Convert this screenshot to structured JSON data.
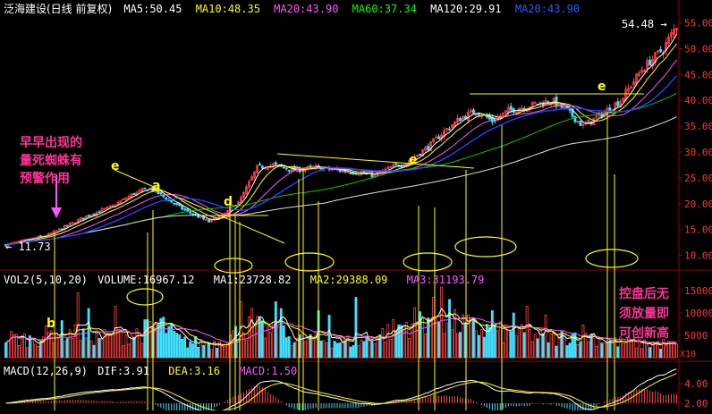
{
  "header": {
    "title": "泛海建设(日线 前复权)",
    "ma_items": [
      {
        "label": "MA5:50.45",
        "color": "#ffffff"
      },
      {
        "label": "MA10:48.35",
        "color": "#ffff00"
      },
      {
        "label": "MA20:43.90",
        "color": "#ff55ff"
      },
      {
        "label": "MA60:37.34",
        "color": "#00ff00"
      },
      {
        "label": "MA120:29.91",
        "color": "#ffffff"
      },
      {
        "label": "MA20:43.90",
        "color": "#3355ff"
      }
    ]
  },
  "volume_header": {
    "items": [
      {
        "label": "VOL2(5,10,20)",
        "color": "#ffffff"
      },
      {
        "label": "VOLUME:16967.12",
        "color": "#ffffff"
      },
      {
        "label": "MA1:23728.82",
        "color": "#ffffff"
      },
      {
        "label": "MA2:29388.09",
        "color": "#ffff00"
      },
      {
        "label": "MA3:31193.79",
        "color": "#ff55ff"
      }
    ]
  },
  "macd_header": {
    "items": [
      {
        "label": "MACD(12,26,9)",
        "color": "#ffffff"
      },
      {
        "label": "DIF:3.91",
        "color": "#ffffff"
      },
      {
        "label": "DEA:3.16",
        "color": "#ffff00"
      },
      {
        "label": "MACD:1.50",
        "color": "#ff55ff"
      }
    ]
  },
  "annotations": {
    "note_left": [
      "早早出现的",
      "量死蜘蛛有",
      "预警作用"
    ],
    "note_right": [
      "控盘后无",
      "须放量即",
      "可创新高"
    ],
    "low_label": "11.73",
    "high_label": "54.48",
    "letters": [
      "e",
      "a",
      "d",
      "e",
      "e",
      "b"
    ],
    "vol_unit": "X10"
  },
  "chart_data": {
    "type": "candlestick",
    "price_axis": {
      "ticks": [
        55.0,
        50.0,
        45.0,
        40.0,
        35.0,
        30.0,
        25.0,
        20.0,
        15.0,
        10.0
      ],
      "tick_labels": [
        "55.00",
        "50.00",
        "45.00",
        "40.00",
        "35.00",
        "30.00",
        "25.00",
        "20.00",
        "15.00",
        "10.00"
      ]
    },
    "volume_axis": {
      "ticks": [
        15000,
        10000,
        5000
      ],
      "tick_labels": [
        "15000",
        "10000",
        "5000"
      ]
    },
    "macd_axis": {
      "ticks": [
        4.0,
        2.0
      ],
      "tick_labels": [
        "4.00",
        "2.00"
      ]
    },
    "price_anchors": [
      [
        0,
        12
      ],
      [
        8,
        13
      ],
      [
        16,
        14
      ],
      [
        24,
        16
      ],
      [
        32,
        18
      ],
      [
        40,
        19.5
      ],
      [
        48,
        22
      ],
      [
        54,
        23
      ],
      [
        60,
        21
      ],
      [
        66,
        19
      ],
      [
        72,
        17.5
      ],
      [
        76,
        16.5
      ],
      [
        82,
        18
      ],
      [
        88,
        21
      ],
      [
        94,
        27
      ],
      [
        100,
        27.5
      ],
      [
        108,
        26.5
      ],
      [
        116,
        27
      ],
      [
        124,
        26.5
      ],
      [
        132,
        26
      ],
      [
        138,
        25.5
      ],
      [
        144,
        27
      ],
      [
        150,
        28
      ],
      [
        158,
        31
      ],
      [
        164,
        34
      ],
      [
        170,
        36.5
      ],
      [
        176,
        38
      ],
      [
        182,
        36
      ],
      [
        188,
        38
      ],
      [
        196,
        39
      ],
      [
        204,
        40
      ],
      [
        210,
        38
      ],
      [
        216,
        35
      ],
      [
        222,
        37
      ],
      [
        230,
        40
      ],
      [
        238,
        46
      ],
      [
        246,
        50
      ],
      [
        251,
        54.5
      ]
    ],
    "volume_anchors": [
      [
        0,
        4500
      ],
      [
        10,
        4000
      ],
      [
        20,
        6000
      ],
      [
        30,
        4800
      ],
      [
        40,
        4500
      ],
      [
        50,
        5500
      ],
      [
        58,
        7500
      ],
      [
        66,
        3500
      ],
      [
        78,
        3200
      ],
      [
        92,
        7000
      ],
      [
        100,
        5500
      ],
      [
        110,
        4200
      ],
      [
        120,
        3800
      ],
      [
        132,
        3500
      ],
      [
        142,
        5500
      ],
      [
        152,
        8000
      ],
      [
        160,
        9500
      ],
      [
        168,
        7500
      ],
      [
        176,
        6500
      ],
      [
        186,
        5500
      ],
      [
        196,
        5000
      ],
      [
        206,
        4200
      ],
      [
        216,
        5500
      ],
      [
        226,
        3500
      ],
      [
        236,
        3200
      ],
      [
        246,
        3000
      ],
      [
        251,
        2800
      ]
    ],
    "volume_spikes": [
      [
        27,
        14500
      ],
      [
        31,
        11000
      ],
      [
        41,
        11500
      ],
      [
        88,
        12500
      ],
      [
        92,
        11000
      ],
      [
        101,
        12500
      ],
      [
        103,
        11000
      ],
      [
        117,
        10500
      ],
      [
        121,
        9500
      ],
      [
        131,
        13500
      ],
      [
        163,
        15800
      ],
      [
        166,
        13000
      ],
      [
        182,
        10500
      ],
      [
        190,
        10000
      ],
      [
        195,
        11500
      ],
      [
        202,
        9500
      ]
    ],
    "bars_count": 252
  }
}
